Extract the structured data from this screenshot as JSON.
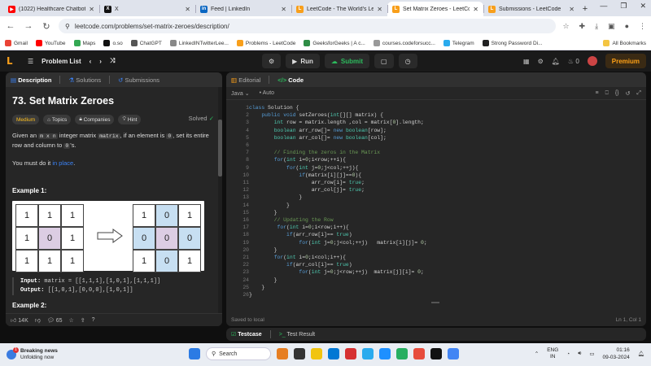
{
  "browser": {
    "tabs": [
      {
        "title": "(1022) Healthcare Chatbot",
        "color": "#ff0000",
        "glyph": "▶"
      },
      {
        "title": "X",
        "color": "#111111",
        "glyph": "X"
      },
      {
        "title": "Feed | LinkedIn",
        "color": "#0a66c2",
        "glyph": "in"
      },
      {
        "title": "LeetCode - The World's Le...",
        "color": "#f89f1b",
        "glyph": "L"
      },
      {
        "title": "Set Matrix Zeroes - LeetCo...",
        "color": "#f89f1b",
        "glyph": "L",
        "active": true
      },
      {
        "title": "Submissions - LeetCode",
        "color": "#f89f1b",
        "glyph": "L"
      }
    ],
    "url": "leetcode.com/problems/set-matrix-zeroes/description/",
    "bookmarks": [
      {
        "label": "Gmail",
        "color": "#ea4335"
      },
      {
        "label": "YouTube",
        "color": "#ff0000"
      },
      {
        "label": "Maps",
        "color": "#34a853"
      },
      {
        "label": "o.so",
        "color": "#111111"
      },
      {
        "label": "ChatGPT",
        "color": "#555555"
      },
      {
        "label": "LinkedINTwitterLee...",
        "color": "#888888"
      },
      {
        "label": "Problems - LeetCode",
        "color": "#f89f1b"
      },
      {
        "label": "GeeksforGeeks | A c...",
        "color": "#2f8d46"
      },
      {
        "label": "courses.codeforsucc...",
        "color": "#999999"
      },
      {
        "label": "Telegram",
        "color": "#2aabee"
      },
      {
        "label": "Strong Password Di...",
        "color": "#222222"
      }
    ],
    "all_bookmarks": "All Bookmarks"
  },
  "header": {
    "problem_list": "Problem List",
    "run": "Run",
    "submit": "Submit",
    "streak": "0",
    "premium": "Premium"
  },
  "left": {
    "tabs": [
      "Description",
      "Solutions",
      "Submissions"
    ],
    "title": "73. Set Matrix Zeroes",
    "solved": "Solved",
    "chips": [
      "Medium",
      "Topics",
      "Companies",
      "Hint"
    ],
    "p1_a": "Given an ",
    "p1_code1": "m x n",
    "p1_b": " integer matrix ",
    "p1_code2": "matrix",
    "p1_c": ", if an element is ",
    "p1_code3": "0",
    "p1_d": ", set its entire row and column to ",
    "p1_code4": "0",
    "p1_e": "'s.",
    "p2_a": "You must do it ",
    "p2_link": "in place",
    "p2_b": ".",
    "example1": "Example 1:",
    "input_label": "Input:",
    "input_value": "matrix = [[1,1,1],[1,0,1],[1,1,1]]",
    "output_label": "Output:",
    "output_value": "[[1,0,1],[0,0,0],[1,0,1]]",
    "example2": "Example 2:",
    "before": [
      [
        "1",
        "1",
        "1"
      ],
      [
        "1",
        "0",
        "1"
      ],
      [
        "1",
        "1",
        "1"
      ]
    ],
    "after": [
      [
        "1",
        "0",
        "1"
      ],
      [
        "0",
        "0",
        "0"
      ],
      [
        "1",
        "0",
        "1"
      ]
    ],
    "likes": "14K",
    "comments": "65"
  },
  "right": {
    "tabs": [
      "Editorial",
      "Code"
    ],
    "language": "Java",
    "auto": "Auto",
    "saved": "Saved to local",
    "position": "Ln 1, Col 1",
    "code": [
      "class Solution {",
      "    public void setZeroes(int[][] matrix) {",
      "        int row = matrix.length ,col = matrix[0].length;",
      "        boolean arr_row[]= new boolean[row];",
      "        boolean arr_col[]= new boolean[col];",
      "",
      "        // Finding the zeros in the Matrix",
      "        for(int i=0;i<row;++i){",
      "            for(int j=0;j<col;++j){",
      "                if(matrix[i][j]==0){",
      "                    arr_row[i]= true;",
      "                    arr_col[j]= true;",
      "                }",
      "            }",
      "        }",
      "        // Updating the Row",
      "         for(int i=0;i<row;i++){",
      "            if(arr_row[i]== true)",
      "                for(int j=0;j<col;++j)   matrix[i][j]= 0;",
      "        }",
      "        for(int i=0;i<col;i++){",
      "            if(arr_col[i]== true)",
      "                for(int j=0;j<row;++j)  matrix[j][i]= 0;",
      "        }",
      "    }",
      "}"
    ],
    "bottom_tabs": [
      "Testcase",
      "Test Result"
    ]
  },
  "taskbar": {
    "news_title": "Breaking news",
    "news_sub": "Unfolding now",
    "search": "Search",
    "lang1": "ENG",
    "lang2": "IN",
    "time": "01:16",
    "date": "09-03-2024"
  }
}
